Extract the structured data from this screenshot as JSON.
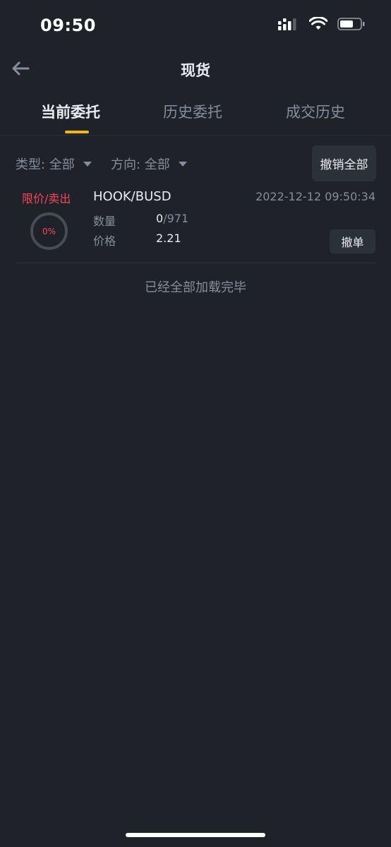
{
  "status_bar": {
    "time": "09:50",
    "icons": [
      "signal-icon",
      "wifi-icon",
      "battery-icon"
    ]
  },
  "header": {
    "title": "现货"
  },
  "tabs": [
    {
      "label": "当前委托",
      "active": true
    },
    {
      "label": "历史委托",
      "active": false
    },
    {
      "label": "成交历史",
      "active": false
    }
  ],
  "filters": {
    "type_label": "类型: 全部",
    "direction_label": "方向: 全部",
    "cancel_all_label": "撤销全部"
  },
  "order": {
    "type": "限价/卖出",
    "pair": "HOOK/BUSD",
    "time": "2022-12-12 09:50:34",
    "progress_text": "0%",
    "progress_fraction": 0,
    "quantity_label": "数量",
    "quantity_filled": "0",
    "quantity_total": "/971",
    "price_label": "价格",
    "price_value": "2.21",
    "cancel_label": "撤单"
  },
  "footer": {
    "loaded_text": "已经全部加载完毕"
  },
  "colors": {
    "background": "#1f2229",
    "accent": "#f0b90b",
    "sell": "#f6465d",
    "muted": "#848e9c"
  }
}
